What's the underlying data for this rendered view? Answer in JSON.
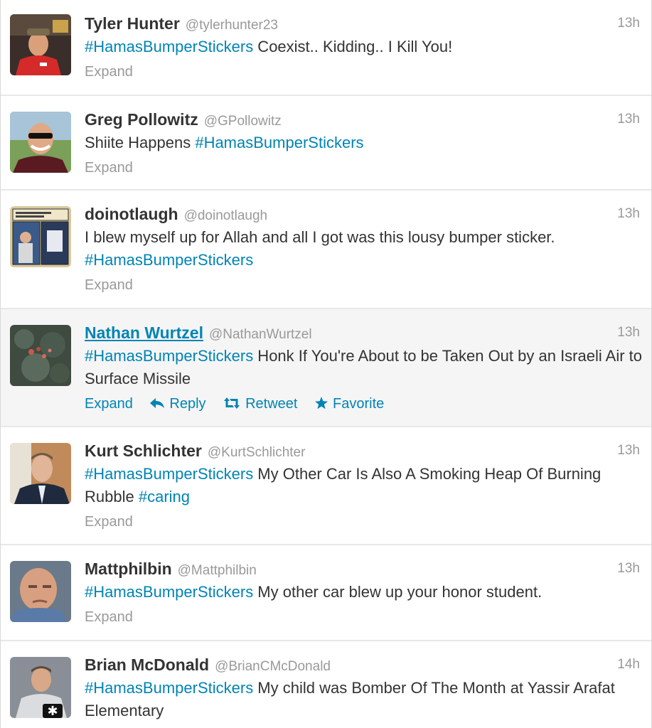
{
  "tweets": [
    {
      "fullname": "Tyler Hunter",
      "username": "@tylerhunter23",
      "time": "13h",
      "text": [
        {
          "t": "#HamasBumperStickers",
          "tag": true
        },
        {
          "t": " Coexist.. Kidding.. I Kill You!",
          "tag": false
        }
      ],
      "expand": "Expand",
      "icon": "person-red-shirt"
    },
    {
      "fullname": "Greg Pollowitz",
      "username": "@GPollowitz",
      "time": "13h",
      "text": [
        {
          "t": "Shiite Happens ",
          "tag": false
        },
        {
          "t": "#HamasBumperStickers",
          "tag": true
        }
      ],
      "expand": "Expand",
      "icon": "person-sunglasses"
    },
    {
      "fullname": "doinotlaugh",
      "username": "@doinotlaugh",
      "time": "13h",
      "text": [
        {
          "t": "I blew myself up for Allah and all I got was this lousy bumper sticker. ",
          "tag": false
        },
        {
          "t": "#HamasBumperStickers",
          "tag": true
        }
      ],
      "expand": "Expand",
      "icon": "comic-panel"
    },
    {
      "fullname": "Nathan Wurtzel",
      "username": "@NathanWurtzel",
      "time": "13h",
      "text": [
        {
          "t": "#HamasBumperStickers",
          "tag": true
        },
        {
          "t": " Honk If You're About to be Taken Out by an Israeli Air to Surface Missile",
          "tag": false
        }
      ],
      "expand": "Expand",
      "reply": "Reply",
      "retweet": "Retweet",
      "favorite": "Favorite",
      "icon": "flower-bush"
    },
    {
      "fullname": "Kurt Schlichter",
      "username": "@KurtSchlichter",
      "time": "13h",
      "text": [
        {
          "t": "#HamasBumperStickers",
          "tag": true
        },
        {
          "t": " My Other Car Is Also A Smoking Heap Of Burning Rubble ",
          "tag": false
        },
        {
          "t": "#caring",
          "tag": true
        }
      ],
      "expand": "Expand",
      "icon": "person-suit"
    },
    {
      "fullname": "Mattphilbin",
      "username": "@Mattphilbin",
      "time": "13h",
      "text": [
        {
          "t": "#HamasBumperStickers",
          "tag": true
        },
        {
          "t": " My other car blew up your honor student.",
          "tag": false
        }
      ],
      "expand": "Expand",
      "icon": "person-bald"
    },
    {
      "fullname": "Brian McDonald",
      "username": "@BrianCMcDonald",
      "time": "14h",
      "text": [
        {
          "t": "#HamasBumperStickers",
          "tag": true
        },
        {
          "t": " My child was Bomber Of The Month at Yassir Arafat Elementary",
          "tag": false
        }
      ],
      "icon": "person-medic"
    }
  ],
  "colors": {
    "link": "#0084b4",
    "meta": "#999999",
    "text": "#333333",
    "hover_bg": "#f5f5f5"
  }
}
